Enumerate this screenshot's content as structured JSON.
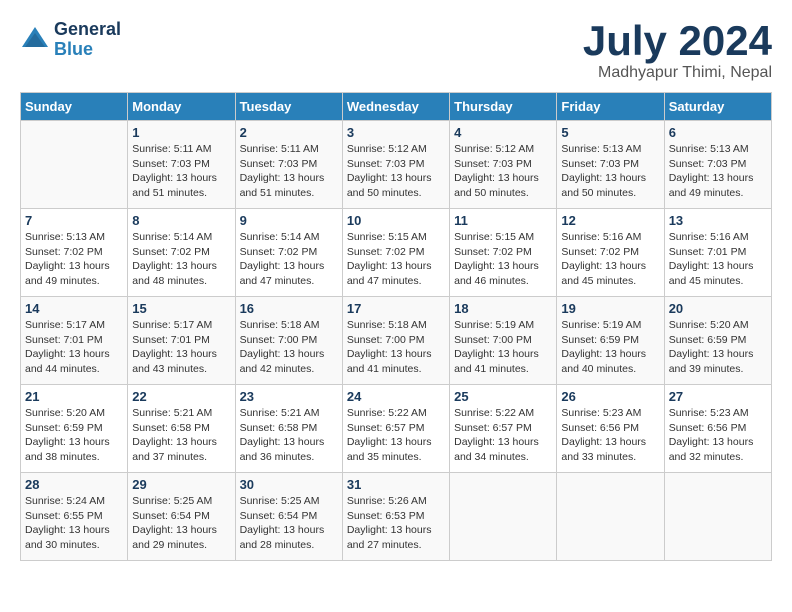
{
  "header": {
    "logo_general": "General",
    "logo_blue": "Blue",
    "month_title": "July 2024",
    "location": "Madhyapur Thimi, Nepal"
  },
  "days_of_week": [
    "Sunday",
    "Monday",
    "Tuesday",
    "Wednesday",
    "Thursday",
    "Friday",
    "Saturday"
  ],
  "weeks": [
    [
      {
        "day": "",
        "info": ""
      },
      {
        "day": "1",
        "info": "Sunrise: 5:11 AM\nSunset: 7:03 PM\nDaylight: 13 hours\nand 51 minutes."
      },
      {
        "day": "2",
        "info": "Sunrise: 5:11 AM\nSunset: 7:03 PM\nDaylight: 13 hours\nand 51 minutes."
      },
      {
        "day": "3",
        "info": "Sunrise: 5:12 AM\nSunset: 7:03 PM\nDaylight: 13 hours\nand 50 minutes."
      },
      {
        "day": "4",
        "info": "Sunrise: 5:12 AM\nSunset: 7:03 PM\nDaylight: 13 hours\nand 50 minutes."
      },
      {
        "day": "5",
        "info": "Sunrise: 5:13 AM\nSunset: 7:03 PM\nDaylight: 13 hours\nand 50 minutes."
      },
      {
        "day": "6",
        "info": "Sunrise: 5:13 AM\nSunset: 7:03 PM\nDaylight: 13 hours\nand 49 minutes."
      }
    ],
    [
      {
        "day": "7",
        "info": "Sunrise: 5:13 AM\nSunset: 7:02 PM\nDaylight: 13 hours\nand 49 minutes."
      },
      {
        "day": "8",
        "info": "Sunrise: 5:14 AM\nSunset: 7:02 PM\nDaylight: 13 hours\nand 48 minutes."
      },
      {
        "day": "9",
        "info": "Sunrise: 5:14 AM\nSunset: 7:02 PM\nDaylight: 13 hours\nand 47 minutes."
      },
      {
        "day": "10",
        "info": "Sunrise: 5:15 AM\nSunset: 7:02 PM\nDaylight: 13 hours\nand 47 minutes."
      },
      {
        "day": "11",
        "info": "Sunrise: 5:15 AM\nSunset: 7:02 PM\nDaylight: 13 hours\nand 46 minutes."
      },
      {
        "day": "12",
        "info": "Sunrise: 5:16 AM\nSunset: 7:02 PM\nDaylight: 13 hours\nand 45 minutes."
      },
      {
        "day": "13",
        "info": "Sunrise: 5:16 AM\nSunset: 7:01 PM\nDaylight: 13 hours\nand 45 minutes."
      }
    ],
    [
      {
        "day": "14",
        "info": "Sunrise: 5:17 AM\nSunset: 7:01 PM\nDaylight: 13 hours\nand 44 minutes."
      },
      {
        "day": "15",
        "info": "Sunrise: 5:17 AM\nSunset: 7:01 PM\nDaylight: 13 hours\nand 43 minutes."
      },
      {
        "day": "16",
        "info": "Sunrise: 5:18 AM\nSunset: 7:00 PM\nDaylight: 13 hours\nand 42 minutes."
      },
      {
        "day": "17",
        "info": "Sunrise: 5:18 AM\nSunset: 7:00 PM\nDaylight: 13 hours\nand 41 minutes."
      },
      {
        "day": "18",
        "info": "Sunrise: 5:19 AM\nSunset: 7:00 PM\nDaylight: 13 hours\nand 41 minutes."
      },
      {
        "day": "19",
        "info": "Sunrise: 5:19 AM\nSunset: 6:59 PM\nDaylight: 13 hours\nand 40 minutes."
      },
      {
        "day": "20",
        "info": "Sunrise: 5:20 AM\nSunset: 6:59 PM\nDaylight: 13 hours\nand 39 minutes."
      }
    ],
    [
      {
        "day": "21",
        "info": "Sunrise: 5:20 AM\nSunset: 6:59 PM\nDaylight: 13 hours\nand 38 minutes."
      },
      {
        "day": "22",
        "info": "Sunrise: 5:21 AM\nSunset: 6:58 PM\nDaylight: 13 hours\nand 37 minutes."
      },
      {
        "day": "23",
        "info": "Sunrise: 5:21 AM\nSunset: 6:58 PM\nDaylight: 13 hours\nand 36 minutes."
      },
      {
        "day": "24",
        "info": "Sunrise: 5:22 AM\nSunset: 6:57 PM\nDaylight: 13 hours\nand 35 minutes."
      },
      {
        "day": "25",
        "info": "Sunrise: 5:22 AM\nSunset: 6:57 PM\nDaylight: 13 hours\nand 34 minutes."
      },
      {
        "day": "26",
        "info": "Sunrise: 5:23 AM\nSunset: 6:56 PM\nDaylight: 13 hours\nand 33 minutes."
      },
      {
        "day": "27",
        "info": "Sunrise: 5:23 AM\nSunset: 6:56 PM\nDaylight: 13 hours\nand 32 minutes."
      }
    ],
    [
      {
        "day": "28",
        "info": "Sunrise: 5:24 AM\nSunset: 6:55 PM\nDaylight: 13 hours\nand 30 minutes."
      },
      {
        "day": "29",
        "info": "Sunrise: 5:25 AM\nSunset: 6:54 PM\nDaylight: 13 hours\nand 29 minutes."
      },
      {
        "day": "30",
        "info": "Sunrise: 5:25 AM\nSunset: 6:54 PM\nDaylight: 13 hours\nand 28 minutes."
      },
      {
        "day": "31",
        "info": "Sunrise: 5:26 AM\nSunset: 6:53 PM\nDaylight: 13 hours\nand 27 minutes."
      },
      {
        "day": "",
        "info": ""
      },
      {
        "day": "",
        "info": ""
      },
      {
        "day": "",
        "info": ""
      }
    ]
  ]
}
